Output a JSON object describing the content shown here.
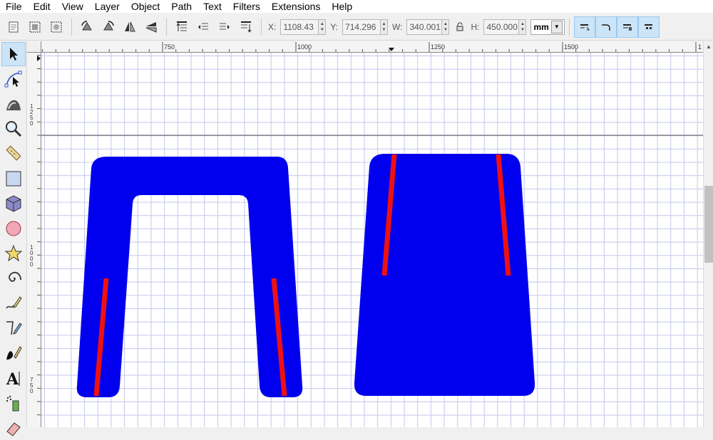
{
  "menu": {
    "items": [
      "File",
      "Edit",
      "View",
      "Layer",
      "Object",
      "Path",
      "Text",
      "Filters",
      "Extensions",
      "Help"
    ]
  },
  "toolbar": {
    "x": {
      "label": "X:",
      "value": "1108.43"
    },
    "y": {
      "label": "Y:",
      "value": "714.296"
    },
    "w": {
      "label": "W:",
      "value": "340.001"
    },
    "h": {
      "label": "H:",
      "value": "450.000"
    },
    "unit": "mm",
    "lock_icon": "lock-icon"
  },
  "rulers": {
    "horizontal_labels": [
      "750",
      "1000",
      "1250",
      "1500",
      "1"
    ],
    "vertical_labels": [
      "1\n2\n5\n0",
      "1\n0\n0\n0",
      "7\n5\n0"
    ]
  },
  "tools": [
    "selector-arrow-icon",
    "node-editor-icon",
    "tweak-icon",
    "zoom-icon",
    "measure-icon",
    "rectangle-icon",
    "3d-box-icon",
    "ellipse-icon",
    "star-icon",
    "spiral-icon",
    "pencil-icon",
    "pen-icon",
    "calligraphy-icon",
    "text-icon",
    "spray-icon",
    "eraser-icon"
  ],
  "colors": {
    "shape_fill": "#0000ee",
    "stripe": "#ee1111",
    "grid": "#c3c6ee",
    "toggle_active": "#cce4f7"
  }
}
